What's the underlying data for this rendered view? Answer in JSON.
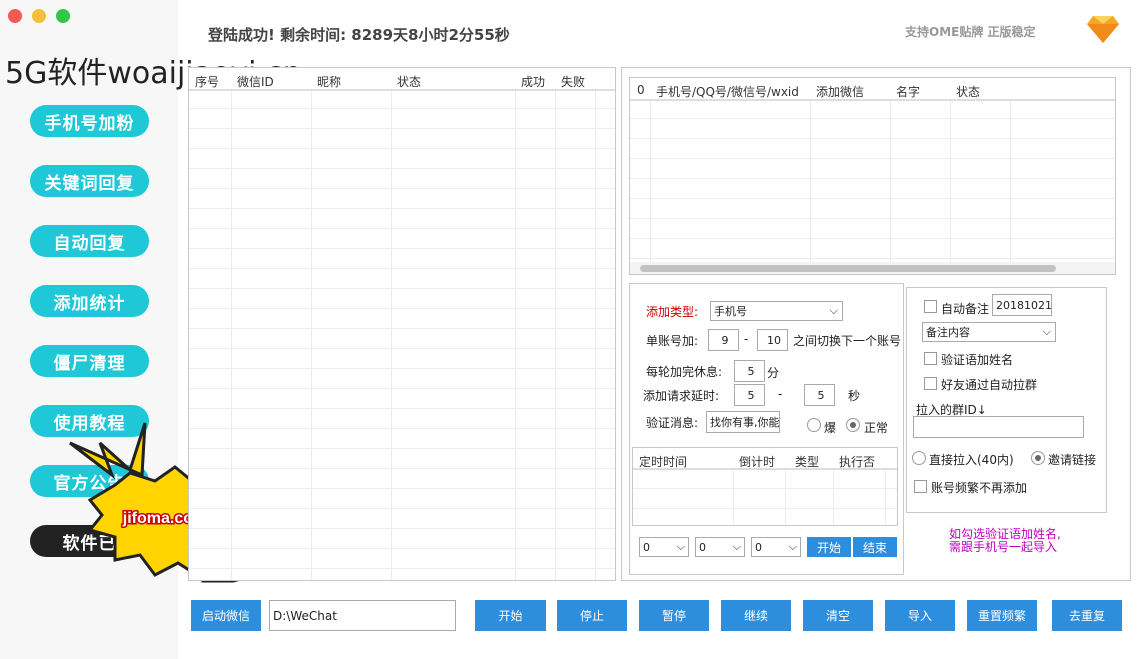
{
  "header": {
    "login_status": "登陆成功!  剩余时间:  8289天8小时2分55秒",
    "slogan": "支持OME贴牌 正版稳定"
  },
  "watermark": "5G软件woaijiaoyi.cn",
  "sidebar": {
    "items": [
      {
        "label": "手机号加粉"
      },
      {
        "label": "关键词回复"
      },
      {
        "label": "自动回复"
      },
      {
        "label": "添加统计"
      },
      {
        "label": "僵尸清理"
      },
      {
        "label": "使用教程"
      },
      {
        "label": "官方公告"
      },
      {
        "label": "软件已"
      }
    ]
  },
  "badge_text": "jifoma.com",
  "left_table": {
    "columns": [
      "序号",
      "微信ID",
      "昵称",
      "状态",
      "成功",
      "失败"
    ]
  },
  "right_table": {
    "columns": [
      "0",
      "手机号/QQ号/微信号/wxid",
      "添加微信",
      "名字",
      "状态"
    ]
  },
  "form": {
    "add_type_label": "添加类型:",
    "add_type_value": "手机号",
    "single_add_label": "单账号加:",
    "single_min": "9",
    "dash": "-",
    "single_max": "10",
    "switch_text": "之间切换下一个账号",
    "rest_label": "每轮加完休息:",
    "rest_value": "5",
    "rest_unit": "分",
    "delay_label": "添加请求延时:",
    "delay_min": "5",
    "delay_max": "5",
    "delay_unit": "秒",
    "verify_label": "验证消息:",
    "verify_value": "找你有事,你能",
    "radio_burst": "爆",
    "radio_normal": "正常"
  },
  "schedule": {
    "columns": [
      "定时时间",
      "倒计时",
      "类型",
      "执行否"
    ],
    "selects": [
      "0",
      "0",
      "0"
    ],
    "start": "开始",
    "end": "结束"
  },
  "options": {
    "auto_remark": "自动备注",
    "remark_date": "20181021",
    "remark_content": "备注内容",
    "verify_add_name": "验证语加姓名",
    "auto_pull_group": "好友通过自动拉群",
    "group_id_label": "拉入的群ID↓",
    "direct_pull": "直接拉入(40内)",
    "invite_link": "邀请链接",
    "no_readd": "账号频繁不再添加",
    "note": "如勾选验证语加姓名,\n需跟手机号一起导入"
  },
  "bottom": {
    "launch": "启动微信",
    "path": "D:\\WeChat",
    "buttons": [
      "开始",
      "停止",
      "暂停",
      "继续",
      "清空",
      "导入",
      "重置频繁",
      "去重复"
    ]
  },
  "colors": {
    "accent": "#1ec8d6",
    "button": "#2e8ede",
    "note": "#c000c0",
    "label_red": "#cc0000"
  }
}
